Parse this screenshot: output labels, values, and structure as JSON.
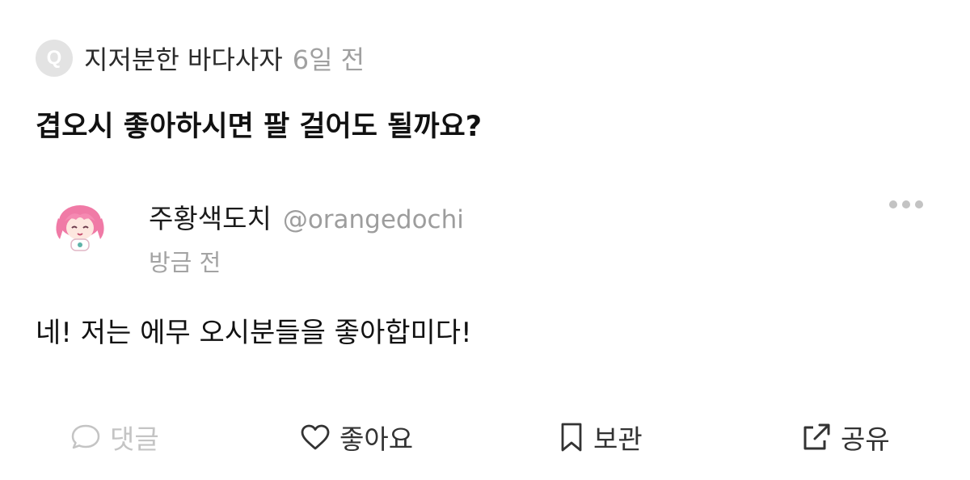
{
  "question": {
    "badge": "Q",
    "author": "지저분한 바다사자",
    "time": "6일 전",
    "text": "겹오시 좋아하시면 팔 걸어도 될까요?"
  },
  "answer": {
    "name": "주황색도치",
    "handle": "@orangedochi",
    "time": "방금 전",
    "text": "네! 저는 에무 오시분들을 좋아합미다!",
    "avatar_icon": "pink-haired-chibi-avatar"
  },
  "actions": {
    "comment": "댓글",
    "like": "좋아요",
    "save": "보관",
    "share": "공유"
  },
  "colors": {
    "muted": "#a0a0a0",
    "disabled": "#c4c4c4",
    "text": "#111111",
    "avatar_hair": "#f07aa6"
  }
}
